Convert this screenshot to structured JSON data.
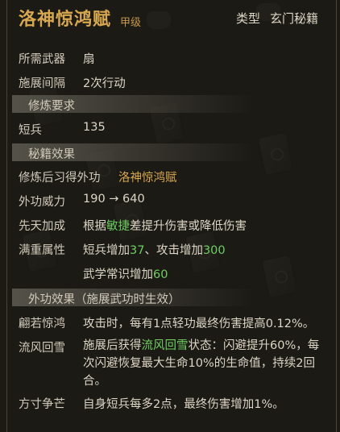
{
  "item": {
    "name": "洛神惊鸿赋",
    "grade": "甲级",
    "type_label": "类型",
    "type_value": "玄门秘籍"
  },
  "basic": [
    {
      "label": "所需武器",
      "value": "扇"
    },
    {
      "label": "施展间隔",
      "value": "2次行动"
    }
  ],
  "requirements": {
    "header": "修炼要求",
    "label": "短兵",
    "value": "135"
  },
  "effects": {
    "header": "秘籍效果",
    "learn_label": "修炼后习得外功",
    "learn_value": "洛神惊鸿赋",
    "power_label": "外功威力",
    "power_value": "190 → 640",
    "bonus_label": "先天加成",
    "bonus_pre": "根据",
    "bonus_stat": "敏捷",
    "bonus_post": "差提升伤害或降低伤害",
    "full_label": "满重属性",
    "full_1_pre": "短兵增加",
    "full_1_num": "37",
    "full_1_mid": "、攻击增加",
    "full_1_num2": "300",
    "full_2_pre": "武学常识增加",
    "full_2_num": "60"
  },
  "outer": {
    "header": "外功效果（施展武功时生效）",
    "e1_label": "翩若惊鸿",
    "e1_text": "攻击时，每有1点轻功最终伤害提高0.12%。",
    "e2_label": "流风回雪",
    "e2_pre": "施展后获得",
    "e2_name": "流风回雪",
    "e2_post": "状态：闪避提升60%，每次闪避恢复最大生命10%的生命值，持续2回合。",
    "e3_label": "方寸争芒",
    "e3_text": "自身短兵每多2点，最终伤害增加1%。"
  },
  "colors": {
    "title": "#d8a84e",
    "highlight": "#6ccf5e",
    "text": "#ddd6c6"
  }
}
